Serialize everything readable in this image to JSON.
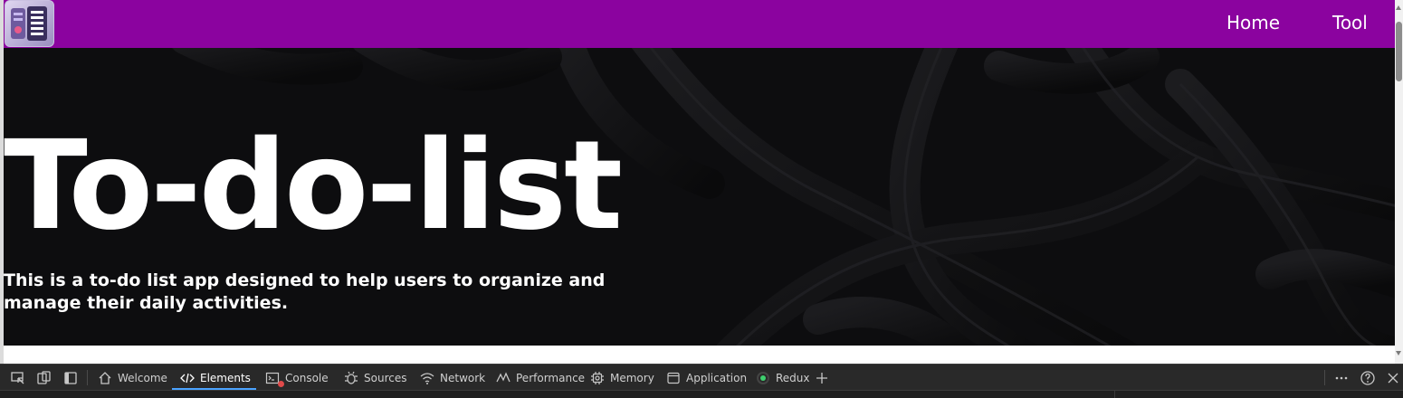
{
  "app": {
    "nav": {
      "links": [
        {
          "label": "Home"
        },
        {
          "label": "Tool"
        }
      ],
      "colors": {
        "navbar_bg": "#8b039f"
      }
    },
    "hero": {
      "title": "To-do-list",
      "description": "This is a to-do list app designed to help users to organize and manage their daily activities."
    }
  },
  "devtools": {
    "tabs": [
      {
        "label": "Welcome",
        "icon": "home-icon"
      },
      {
        "label": "Elements",
        "icon": "code-icon",
        "active": true
      },
      {
        "label": "Console",
        "icon": "console-icon"
      },
      {
        "label": "Sources",
        "icon": "bug-icon"
      },
      {
        "label": "Network",
        "icon": "wifi-icon"
      },
      {
        "label": "Performance",
        "icon": "performance-icon"
      },
      {
        "label": "Memory",
        "icon": "memory-chip-icon"
      },
      {
        "label": "Application",
        "icon": "window-icon"
      },
      {
        "label": "Redux",
        "icon": "redux-icon"
      }
    ],
    "colors": {
      "accent": "#4aa3ff",
      "error_badge": "#e04a4a",
      "redux_dot": "#3ecf6e"
    }
  }
}
